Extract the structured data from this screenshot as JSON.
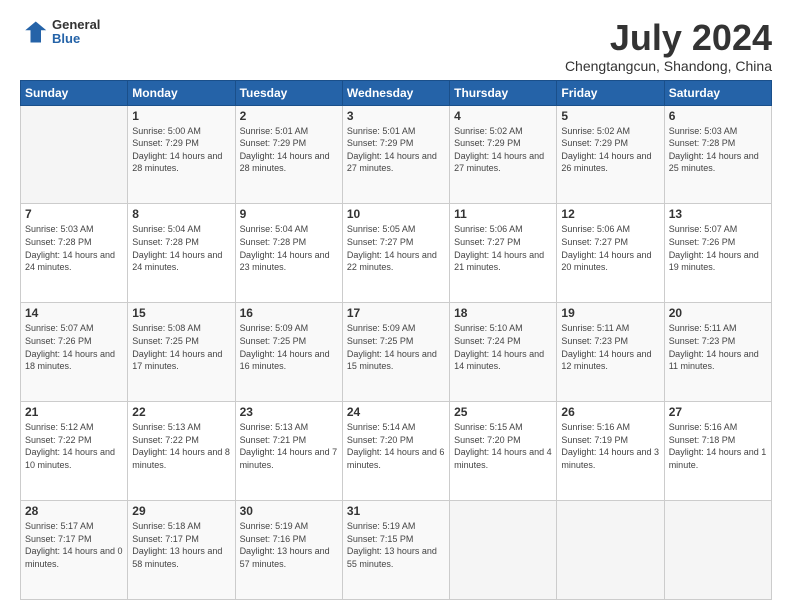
{
  "logo": {
    "general": "General",
    "blue": "Blue"
  },
  "header": {
    "title": "July 2024",
    "subtitle": "Chengtangcun, Shandong, China"
  },
  "days_of_week": [
    "Sunday",
    "Monday",
    "Tuesday",
    "Wednesday",
    "Thursday",
    "Friday",
    "Saturday"
  ],
  "weeks": [
    [
      {
        "day": "",
        "sunrise": "",
        "sunset": "",
        "daylight": ""
      },
      {
        "day": "1",
        "sunrise": "5:00 AM",
        "sunset": "7:29 PM",
        "daylight": "14 hours and 28 minutes."
      },
      {
        "day": "2",
        "sunrise": "5:01 AM",
        "sunset": "7:29 PM",
        "daylight": "14 hours and 28 minutes."
      },
      {
        "day": "3",
        "sunrise": "5:01 AM",
        "sunset": "7:29 PM",
        "daylight": "14 hours and 27 minutes."
      },
      {
        "day": "4",
        "sunrise": "5:02 AM",
        "sunset": "7:29 PM",
        "daylight": "14 hours and 27 minutes."
      },
      {
        "day": "5",
        "sunrise": "5:02 AM",
        "sunset": "7:29 PM",
        "daylight": "14 hours and 26 minutes."
      },
      {
        "day": "6",
        "sunrise": "5:03 AM",
        "sunset": "7:28 PM",
        "daylight": "14 hours and 25 minutes."
      }
    ],
    [
      {
        "day": "7",
        "sunrise": "5:03 AM",
        "sunset": "7:28 PM",
        "daylight": "14 hours and 24 minutes."
      },
      {
        "day": "8",
        "sunrise": "5:04 AM",
        "sunset": "7:28 PM",
        "daylight": "14 hours and 24 minutes."
      },
      {
        "day": "9",
        "sunrise": "5:04 AM",
        "sunset": "7:28 PM",
        "daylight": "14 hours and 23 minutes."
      },
      {
        "day": "10",
        "sunrise": "5:05 AM",
        "sunset": "7:27 PM",
        "daylight": "14 hours and 22 minutes."
      },
      {
        "day": "11",
        "sunrise": "5:06 AM",
        "sunset": "7:27 PM",
        "daylight": "14 hours and 21 minutes."
      },
      {
        "day": "12",
        "sunrise": "5:06 AM",
        "sunset": "7:27 PM",
        "daylight": "14 hours and 20 minutes."
      },
      {
        "day": "13",
        "sunrise": "5:07 AM",
        "sunset": "7:26 PM",
        "daylight": "14 hours and 19 minutes."
      }
    ],
    [
      {
        "day": "14",
        "sunrise": "5:07 AM",
        "sunset": "7:26 PM",
        "daylight": "14 hours and 18 minutes."
      },
      {
        "day": "15",
        "sunrise": "5:08 AM",
        "sunset": "7:25 PM",
        "daylight": "14 hours and 17 minutes."
      },
      {
        "day": "16",
        "sunrise": "5:09 AM",
        "sunset": "7:25 PM",
        "daylight": "14 hours and 16 minutes."
      },
      {
        "day": "17",
        "sunrise": "5:09 AM",
        "sunset": "7:25 PM",
        "daylight": "14 hours and 15 minutes."
      },
      {
        "day": "18",
        "sunrise": "5:10 AM",
        "sunset": "7:24 PM",
        "daylight": "14 hours and 14 minutes."
      },
      {
        "day": "19",
        "sunrise": "5:11 AM",
        "sunset": "7:23 PM",
        "daylight": "14 hours and 12 minutes."
      },
      {
        "day": "20",
        "sunrise": "5:11 AM",
        "sunset": "7:23 PM",
        "daylight": "14 hours and 11 minutes."
      }
    ],
    [
      {
        "day": "21",
        "sunrise": "5:12 AM",
        "sunset": "7:22 PM",
        "daylight": "14 hours and 10 minutes."
      },
      {
        "day": "22",
        "sunrise": "5:13 AM",
        "sunset": "7:22 PM",
        "daylight": "14 hours and 8 minutes."
      },
      {
        "day": "23",
        "sunrise": "5:13 AM",
        "sunset": "7:21 PM",
        "daylight": "14 hours and 7 minutes."
      },
      {
        "day": "24",
        "sunrise": "5:14 AM",
        "sunset": "7:20 PM",
        "daylight": "14 hours and 6 minutes."
      },
      {
        "day": "25",
        "sunrise": "5:15 AM",
        "sunset": "7:20 PM",
        "daylight": "14 hours and 4 minutes."
      },
      {
        "day": "26",
        "sunrise": "5:16 AM",
        "sunset": "7:19 PM",
        "daylight": "14 hours and 3 minutes."
      },
      {
        "day": "27",
        "sunrise": "5:16 AM",
        "sunset": "7:18 PM",
        "daylight": "14 hours and 1 minute."
      }
    ],
    [
      {
        "day": "28",
        "sunrise": "5:17 AM",
        "sunset": "7:17 PM",
        "daylight": "14 hours and 0 minutes."
      },
      {
        "day": "29",
        "sunrise": "5:18 AM",
        "sunset": "7:17 PM",
        "daylight": "13 hours and 58 minutes."
      },
      {
        "day": "30",
        "sunrise": "5:19 AM",
        "sunset": "7:16 PM",
        "daylight": "13 hours and 57 minutes."
      },
      {
        "day": "31",
        "sunrise": "5:19 AM",
        "sunset": "7:15 PM",
        "daylight": "13 hours and 55 minutes."
      },
      {
        "day": "",
        "sunrise": "",
        "sunset": "",
        "daylight": ""
      },
      {
        "day": "",
        "sunrise": "",
        "sunset": "",
        "daylight": ""
      },
      {
        "day": "",
        "sunrise": "",
        "sunset": "",
        "daylight": ""
      }
    ]
  ]
}
